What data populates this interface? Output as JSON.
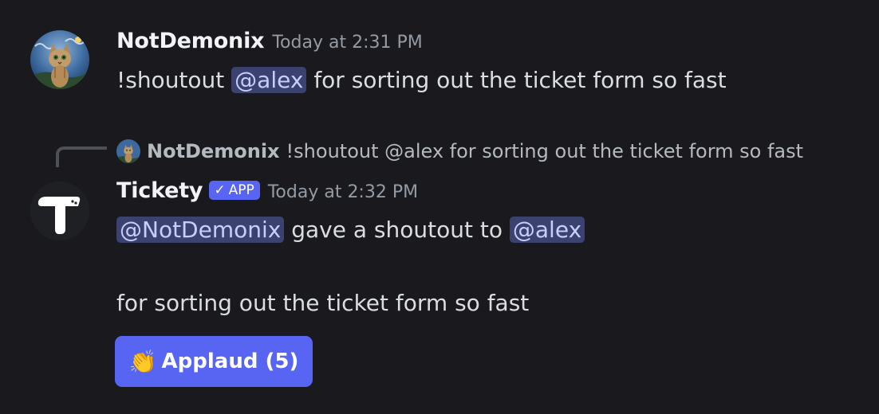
{
  "messages": [
    {
      "author": "NotDemonix",
      "timestamp": "Today at 2:31 PM",
      "content_prefix": "!shoutout ",
      "mention": "@alex",
      "content_suffix": " for sorting out the ticket form so fast",
      "avatar_icon": "cat-painting-avatar"
    },
    {
      "author": "Tickety",
      "badge": "APP",
      "badge_check": "✓",
      "timestamp": "Today at 2:32 PM",
      "mention_from": "@NotDemonix",
      "middle_text": " gave a shoutout to ",
      "mention_to": "@alex",
      "second_line": "for sorting out the ticket form so fast",
      "avatar_icon": "tickety-logo-avatar",
      "reply": {
        "author": "NotDemonix",
        "text": "!shoutout @alex for sorting out the ticket form so fast"
      },
      "button": {
        "emoji": "👏",
        "label": "Applaud (5)"
      }
    }
  ],
  "colors": {
    "background": "#1a1a1e",
    "mention_bg": "#3c4270",
    "mention_text": "#c9cdfb",
    "accent": "#5865f2"
  }
}
